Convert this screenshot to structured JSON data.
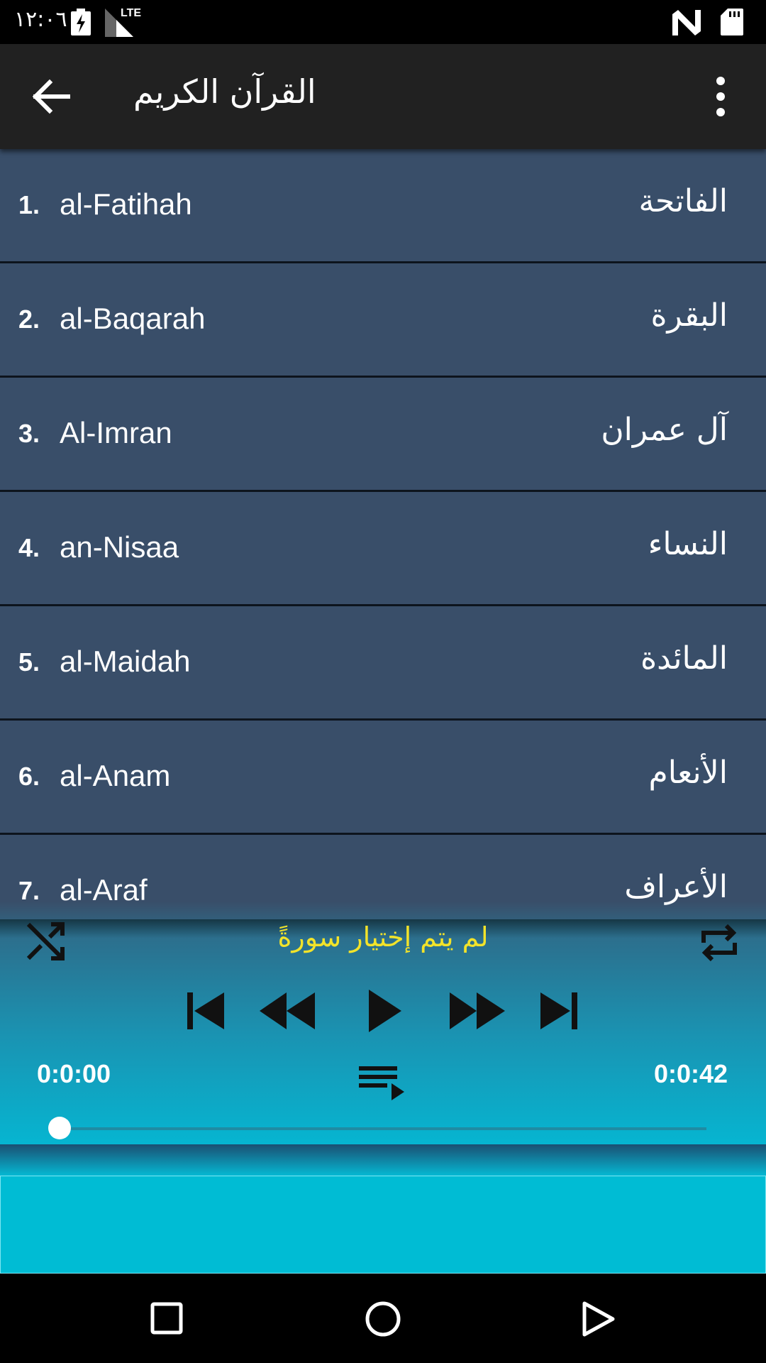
{
  "status_bar": {
    "time": "١٢:٠٦",
    "icons": [
      "battery-charging-icon",
      "signal-lte-icon",
      "nfc-icon",
      "sd-card-icon"
    ],
    "network_label": "LTE"
  },
  "app_bar": {
    "title": "القرآن الكريم",
    "back_icon": "arrow-back-icon",
    "menu_icon": "more-vert-icon"
  },
  "surahs": [
    {
      "number": "1.",
      "latin": "al-Fatihah",
      "arabic": "الفاتحة"
    },
    {
      "number": "2.",
      "latin": "al-Baqarah",
      "arabic": "البقرة"
    },
    {
      "number": "3.",
      "latin": "Al-Imran",
      "arabic": "آل عمران"
    },
    {
      "number": "4.",
      "latin": "an-Nisaa",
      "arabic": "النساء"
    },
    {
      "number": "5.",
      "latin": "al-Maidah",
      "arabic": "المائدة"
    },
    {
      "number": "6.",
      "latin": "al-Anam",
      "arabic": "الأنعام"
    },
    {
      "number": "7.",
      "latin": "al-Araf",
      "arabic": "الأعراف"
    }
  ],
  "player": {
    "status_text": "لم يتم إختيار سورةً",
    "current_time": "0:0:00",
    "total_time": "0:0:42",
    "progress": 0,
    "icons": [
      "shuffle-icon",
      "repeat-icon",
      "skip-previous-icon",
      "rewind-icon",
      "play-icon",
      "fast-forward-icon",
      "skip-next-icon",
      "playlist-icon"
    ]
  },
  "colors": {
    "row_bg": "#394e69",
    "row_divider": "#0d141d",
    "app_bar": "#212121",
    "status_text": "#f2e32a",
    "player_bottom": "#06b5d1",
    "ad_area": "#00bcd4"
  },
  "nav_bar": {
    "icons": [
      "recents-square-icon",
      "home-circle-icon",
      "back-triangle-icon"
    ]
  }
}
